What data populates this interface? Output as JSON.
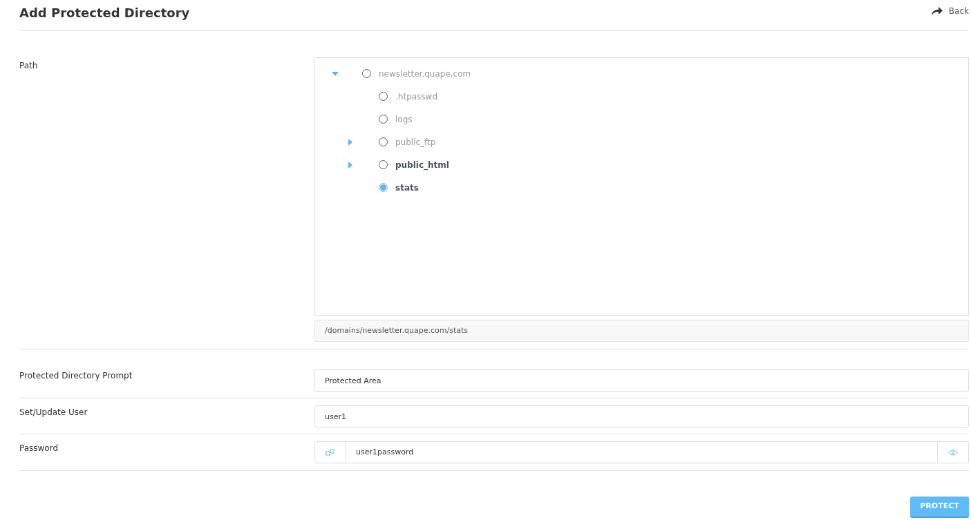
{
  "title": "Add Protected Directory",
  "back": {
    "label": "Back"
  },
  "path": {
    "label": "Path",
    "tree": [
      {
        "label": "newsletter.quape.com",
        "selected": false,
        "bold": false,
        "expanded": true,
        "children": [
          {
            "label": ".htpasswd",
            "selected": false,
            "bold": false
          },
          {
            "label": "logs",
            "selected": false,
            "bold": false
          },
          {
            "label": "public_ftp",
            "selected": false,
            "bold": false,
            "expanded": false
          },
          {
            "label": "public_html",
            "selected": false,
            "bold": true,
            "expanded": false
          },
          {
            "label": "stats",
            "selected": true,
            "bold": true
          }
        ]
      }
    ],
    "value": "/domains/newsletter.quape.com/stats"
  },
  "prompt": {
    "label": "Protected Directory Prompt",
    "value": "Protected Area"
  },
  "user": {
    "label": "Set/Update User",
    "value": "user1"
  },
  "password": {
    "label": "Password",
    "value": "user1password"
  },
  "submit": "PROTECT"
}
